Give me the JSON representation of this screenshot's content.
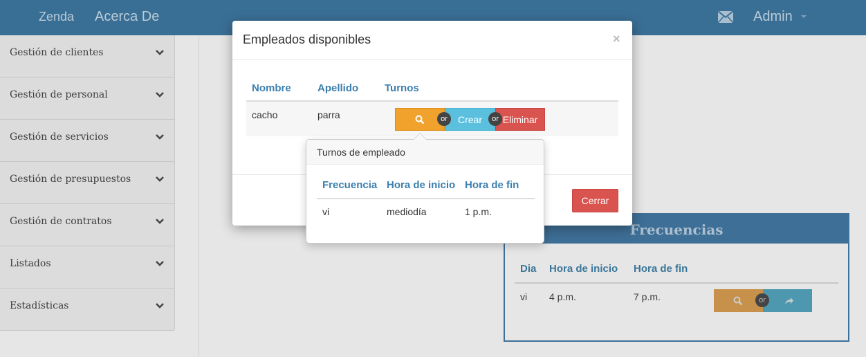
{
  "navbar": {
    "brand": "Zenda",
    "about": "Acerca De",
    "user": "Admin",
    "icons": {
      "mail": "envelope-icon",
      "caret": "caret-down-icon"
    }
  },
  "sidebar": {
    "items": [
      {
        "label": "Gestión de clientes"
      },
      {
        "label": "Gestión de personal"
      },
      {
        "label": "Gestión de servicios"
      },
      {
        "label": "Gestión de presupuestos"
      },
      {
        "label": "Gestión de contratos"
      },
      {
        "label": "Listados"
      },
      {
        "label": "Estadísticas"
      }
    ]
  },
  "frecuencias": {
    "title": "Frecuencias",
    "headers": [
      "Dia",
      "Hora de inicio",
      "Hora de fin"
    ],
    "rows": [
      {
        "dia": "vi",
        "inicio": "4 p.m.",
        "fin": "7 p.m."
      }
    ],
    "or": "or"
  },
  "modal": {
    "title": "Empleados disponibles",
    "close": "×",
    "headers": [
      "Nombre",
      "Apellido",
      "Turnos"
    ],
    "rows": [
      {
        "nombre": "cacho",
        "apellido": "parra"
      }
    ],
    "or": "or",
    "buttons": {
      "crear": "Crear",
      "eliminar": "Eliminar",
      "cerrar": "Cerrar"
    }
  },
  "popover": {
    "title": "Turnos de empleado",
    "headers": [
      "Frecuencia",
      "Hora de inicio",
      "Hora de fin"
    ],
    "rows": [
      {
        "frecuencia": "vi",
        "inicio": "mediodía",
        "fin": "1 p.m."
      }
    ]
  },
  "colors": {
    "navbar": "#3a6f95",
    "primary_text": "#3b7fae",
    "warning": "#f0a22c",
    "info": "#5bc0de",
    "danger": "#d9534f"
  }
}
